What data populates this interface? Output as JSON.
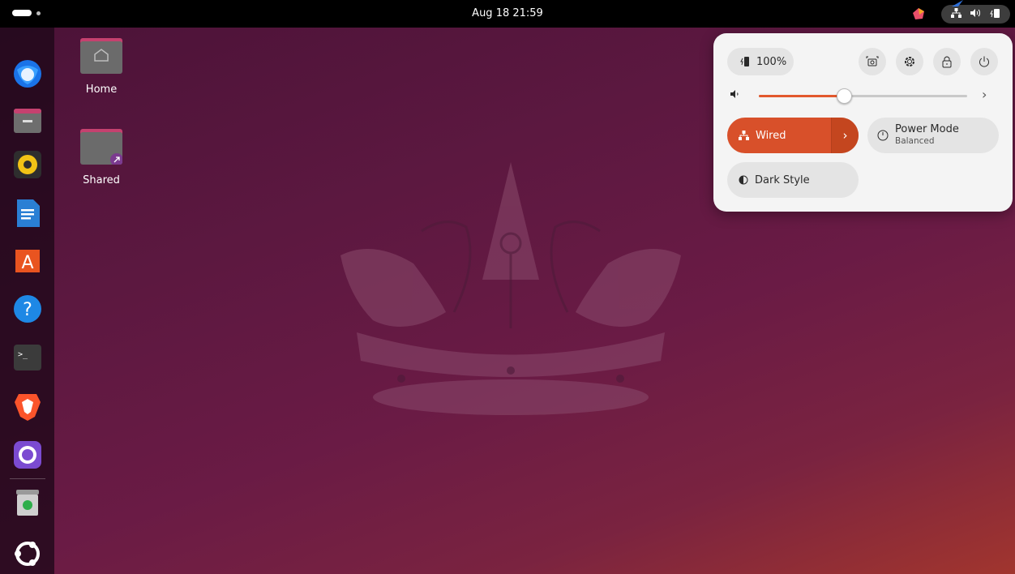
{
  "topbar": {
    "clock": "Aug 18  21:59"
  },
  "desktop": {
    "icons": [
      {
        "label": "Home",
        "icon": "home-folder-icon"
      },
      {
        "label": "Shared",
        "icon": "shared-folder-icon"
      }
    ]
  },
  "dock": {
    "apps": [
      {
        "name": "Thunderbird",
        "icon": "thunderbird-icon"
      },
      {
        "name": "Files",
        "icon": "files-icon"
      },
      {
        "name": "Rhythmbox",
        "icon": "rhythmbox-icon"
      },
      {
        "name": "LibreOffice Writer",
        "icon": "writer-icon"
      },
      {
        "name": "App Center",
        "icon": "app-center-icon"
      },
      {
        "name": "Help",
        "icon": "help-icon"
      },
      {
        "name": "Terminal",
        "icon": "terminal-icon"
      },
      {
        "name": "Brave",
        "icon": "brave-icon"
      },
      {
        "name": "GitHub Desktop",
        "icon": "github-icon"
      },
      {
        "name": "Trash",
        "icon": "trash-icon"
      },
      {
        "name": "Show Apps",
        "icon": "ubuntu-apps-icon"
      }
    ]
  },
  "quick_settings": {
    "battery_label": "100%",
    "volume_level": 0.41,
    "wired": {
      "label": "Wired",
      "active": true
    },
    "power_mode": {
      "title": "Power Mode",
      "subtitle": "Balanced"
    },
    "dark_style": {
      "label": "Dark Style",
      "active": false
    }
  },
  "colors": {
    "accent": "#d8502a",
    "panel_bg": "#f4f4f4",
    "topbar_bg": "#000000"
  }
}
